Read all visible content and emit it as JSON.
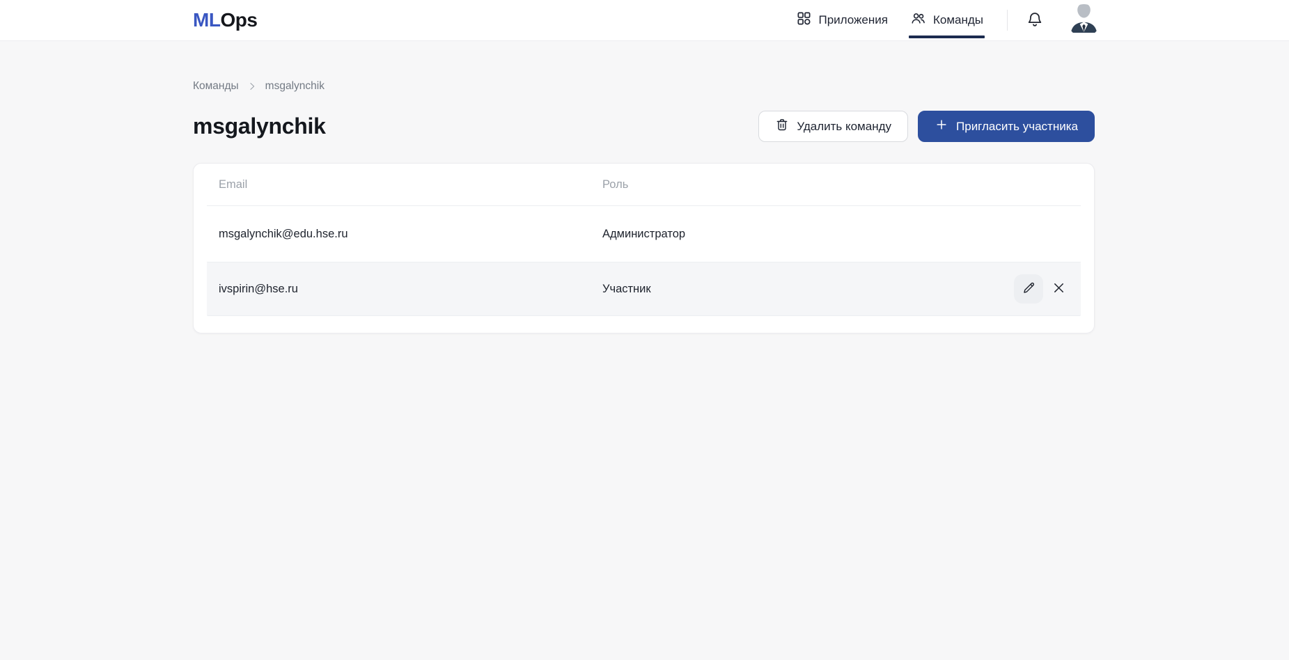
{
  "header": {
    "logo": {
      "ml": "ML",
      "ops": "Ops"
    },
    "nav": [
      {
        "label": "Приложения",
        "icon": "apps-grid-icon",
        "active": false
      },
      {
        "label": "Команды",
        "icon": "teams-people-icon",
        "active": true
      }
    ],
    "icons": {
      "notifications": "bell-icon",
      "profile": "avatar-person-in-suit"
    }
  },
  "breadcrumb": {
    "root": "Команды",
    "current": "msgalynchik"
  },
  "page": {
    "title": "msgalynchik"
  },
  "actions": {
    "delete_team": "Удалить команду",
    "invite_member": "Пригласить участника"
  },
  "table": {
    "columns": [
      "Email",
      "Роль"
    ],
    "rows": [
      {
        "email": "msgalynchik@edu.hse.ru",
        "role": "Администратор",
        "hovered": false
      },
      {
        "email": "ivspirin@hse.ru",
        "role": "Участник",
        "hovered": true
      }
    ],
    "row_action_icons": [
      "pencil-edit-icon",
      "close-x-icon"
    ]
  },
  "colors": {
    "logo_blue": "#3a57c2",
    "primary_button_blue": "#2d4f9e",
    "active_tab_underline": "#1c2b4f",
    "page_background": "#f7f7f8",
    "hovered_row_background": "#f5f6f8"
  }
}
